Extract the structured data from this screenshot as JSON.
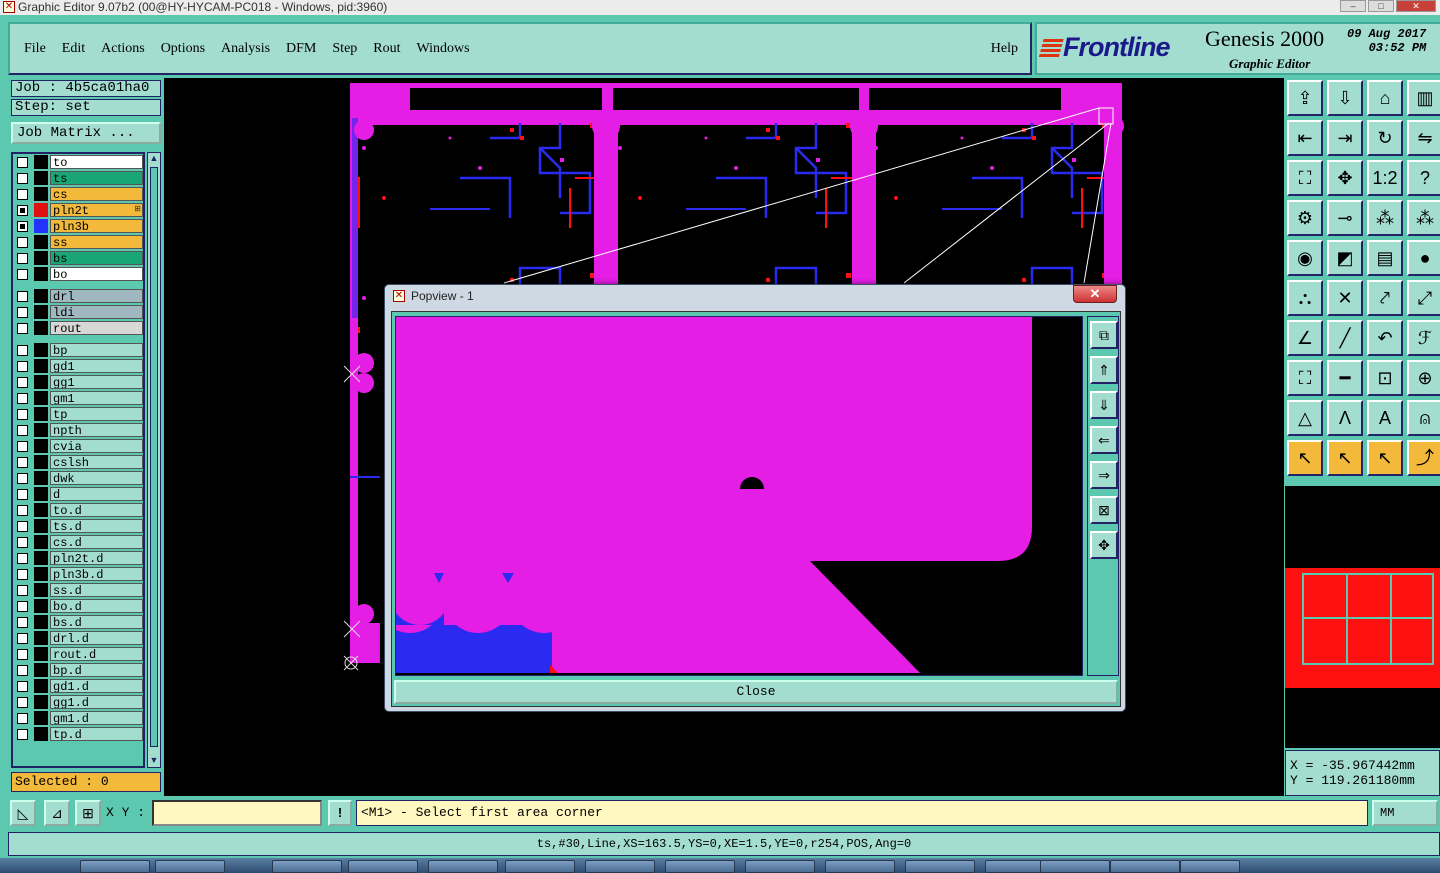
{
  "window": {
    "title": "Graphic Editor 9.07b2 (00@HY-HYCAM-PC018 - Windows, pid:3960)"
  },
  "menubar": {
    "items": [
      "File",
      "Edit",
      "Actions",
      "Options",
      "Analysis",
      "DFM",
      "Step",
      "Rout",
      "Windows"
    ],
    "help": "Help"
  },
  "brand": {
    "logo": "Frontline",
    "product": "Genesis 2000",
    "subtitle": "Graphic Editor",
    "date": "09 Aug 2017",
    "time": "03:52 PM"
  },
  "job": {
    "job_label": "Job : 4b5ca01ha0",
    "step_label": "Step: set",
    "matrix_button": "Job Matrix ..."
  },
  "layers": {
    "board": [
      {
        "name": "to",
        "color": "#ffffff",
        "swatch": "#000000"
      },
      {
        "name": "ts",
        "color": "#1aa576",
        "swatch": "#000000"
      },
      {
        "name": "cs",
        "color": "#f2b93a",
        "swatch": "#000000"
      },
      {
        "name": "pln2t",
        "color": "#f2b93a",
        "swatch": "#e01010",
        "active": true
      },
      {
        "name": "pln3b",
        "color": "#f2b93a",
        "swatch": "#2233ff",
        "active": true
      },
      {
        "name": "ss",
        "color": "#f2b93a",
        "swatch": "#000000"
      },
      {
        "name": "bs",
        "color": "#1aa576",
        "swatch": "#000000"
      },
      {
        "name": "bo",
        "color": "#ffffff",
        "swatch": "#000000"
      }
    ],
    "drill": [
      {
        "name": "drl",
        "color": "#a0b8c0",
        "swatch": "#000000"
      },
      {
        "name": "ldi",
        "color": "#a0b8c0",
        "swatch": "#000000"
      },
      {
        "name": "rout",
        "color": "#d8d8d8",
        "swatch": "#000000"
      }
    ],
    "misc": [
      "bp",
      "gd1",
      "gg1",
      "gm1",
      "tp",
      "npth",
      "cvia",
      "cslsh",
      "dwk",
      "d",
      "to.d",
      "ts.d",
      "cs.d",
      "pln2t.d",
      "pln3b.d",
      "ss.d",
      "bo.d",
      "bs.d",
      "drl.d",
      "rout.d",
      "bp.d",
      "gd1.d",
      "gg1.d",
      "gm1.d",
      "tp.d"
    ]
  },
  "selected": "Selected : 0",
  "coords": {
    "x": "X = -35.967442mm",
    "y": "Y = 119.261180mm"
  },
  "input": {
    "xy_label": "X Y :",
    "xy_value": "",
    "prompt": "<M1> - Select first area corner",
    "units": "MM"
  },
  "status": "ts,#30,Line,XS=163.5,YS=0,XE=1.5,YE=0,r254,POS,Ang=0",
  "popview": {
    "title": "Popview - 1",
    "close_label": "Close"
  },
  "colors": {
    "teal": "#5cc8b0",
    "light_teal": "#a3ddd0",
    "magenta": "#e41ee4",
    "blue": "#2a2af0",
    "red": "#ff1010",
    "yellow": "#f2b93a"
  }
}
